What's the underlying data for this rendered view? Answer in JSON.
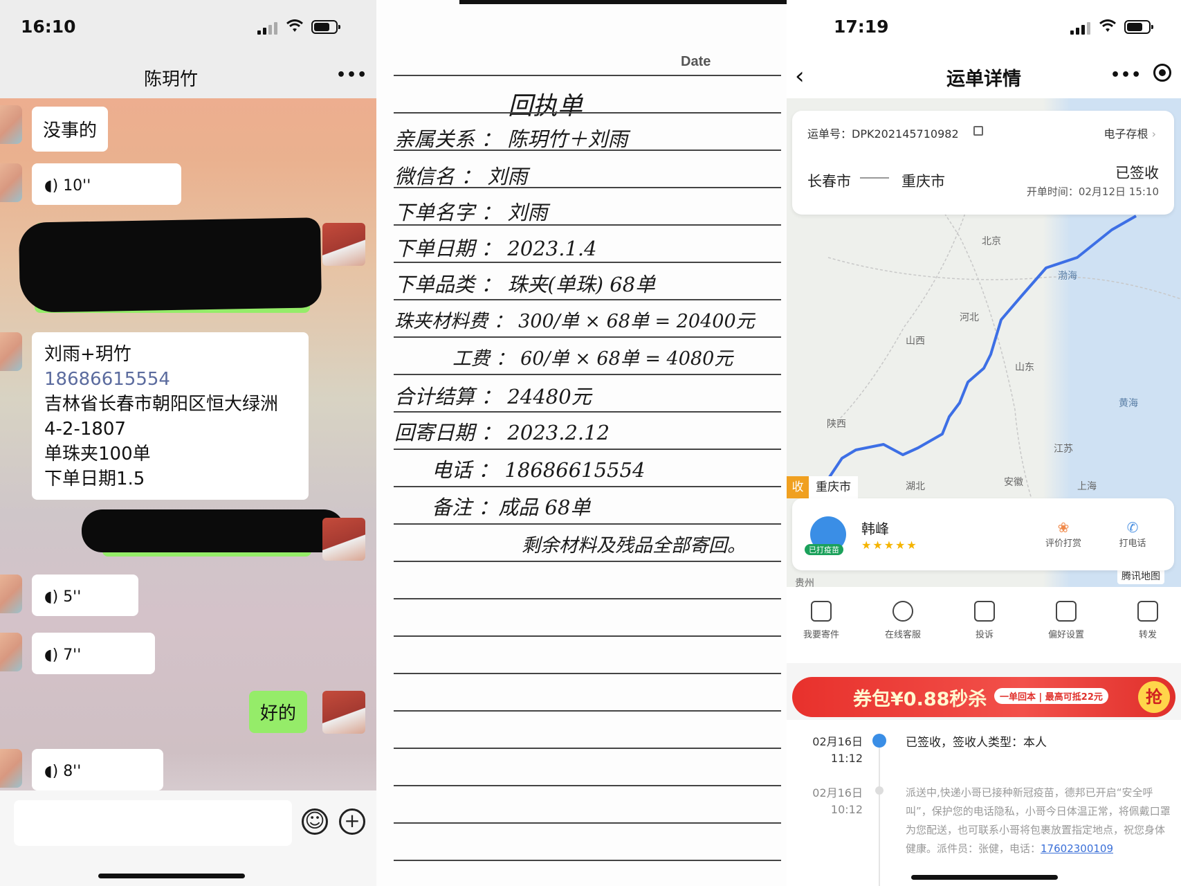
{
  "chat": {
    "time": "16:10",
    "title": "陈玥竹",
    "messages": {
      "m1": "没事的",
      "m2": "10''",
      "m3_line1": "刘雨+玥竹",
      "m3_phone": "18686615554",
      "m3_line3": "吉林省长春市朝阳区恒大绿洲",
      "m3_line4": "4-2-1807",
      "m3_line5": "单珠夹100单",
      "m3_line6": "下单日期1.5",
      "m4": "5''",
      "m5": "7''",
      "m6": "好的",
      "m7": "8''"
    }
  },
  "note": {
    "date_label": "Date",
    "title": "回执单",
    "lines": [
      "亲属关系 ： 陈玥竹＋刘雨",
      "微信名 ： 刘雨",
      "下单名字 ： 刘雨",
      "下单日期 ： 2023.1.4",
      "下单品类 ： 珠夹(单珠) 68单",
      "珠夹材料费 ： 300/单 × 68单 = 20400元",
      "工费 ： 60/单 × 68单 = 4080元",
      "合计结算 ： 24480元",
      "回寄日期 ： 2023.2.12",
      "电话 ： 18686615554",
      "备注 ：成品 68单",
      "剩余材料及残品全部寄回。"
    ]
  },
  "waybill": {
    "time": "17:19",
    "title": "运单详情",
    "order_label": "运单号：",
    "order_no": "DPK202145710982",
    "stub": "电子存根",
    "from": "长春市",
    "to": "重庆市",
    "status": "已签收",
    "open_time": "开单时间：02月12日 15:10",
    "map_labels": [
      "北京",
      "渤海",
      "河北",
      "山西",
      "山东",
      "黄海",
      "陕西",
      "江苏",
      "湖北",
      "安徽",
      "上海",
      "贵州"
    ],
    "receive_tag": "收",
    "receive_city": "重庆市",
    "courier": "韩峰",
    "vaccine": "已打疫苗",
    "rate_label": "评价打赏",
    "call_label": "打电话",
    "map_brand": "腾讯地图",
    "actions": [
      "我要寄件",
      "在线客服",
      "投诉",
      "偏好设置",
      "转发"
    ],
    "banner": {
      "main": "券包¥0.88秒杀",
      "sub": "一单回本 | 最高可抵22元",
      "btn": "抢"
    },
    "events": [
      {
        "date": "02月16日",
        "time": "11:12",
        "text": "已签收，签收人类型：本人"
      },
      {
        "date": "02月16日",
        "time": "10:12",
        "text": "派送中,快递小哥已接种新冠疫苗，德邦已开启“安全呼叫”，保护您的电话隐私，小哥今日体温正常，将佩戴口罩为您配送，也可联系小哥将包裹放置指定地点，祝您身体健康。派件员：张健，电话：",
        "phone": "17602300109"
      }
    ]
  }
}
